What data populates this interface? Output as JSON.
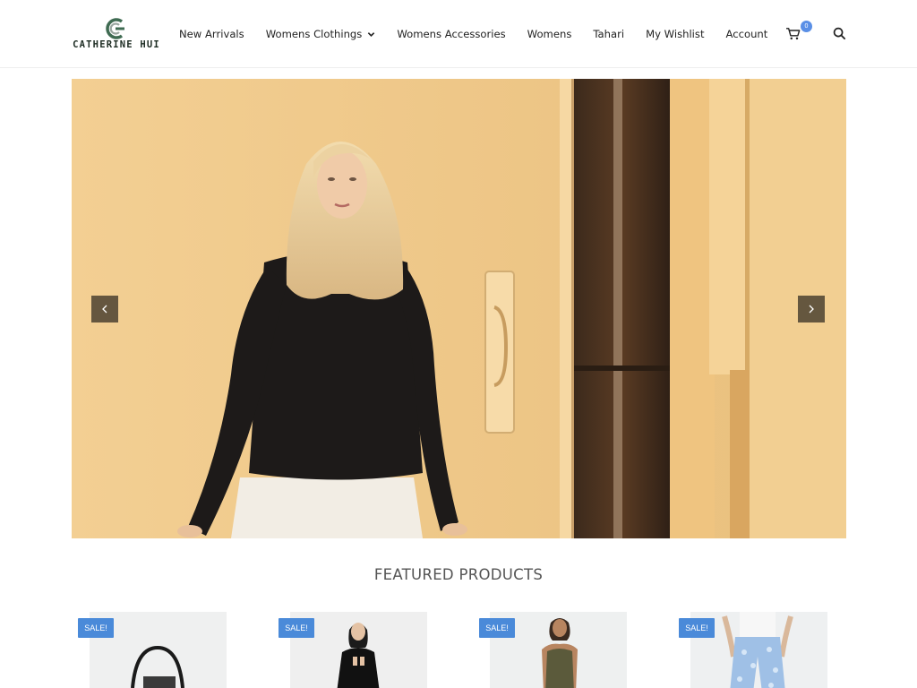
{
  "brand": {
    "name": "CATHERINE HUI"
  },
  "nav": {
    "items": [
      {
        "label": "New Arrivals"
      },
      {
        "label": "Womens Clothings"
      },
      {
        "label": "Womens Accessories"
      },
      {
        "label": "Womens"
      },
      {
        "label": "Tahari"
      },
      {
        "label": "My Wishlist"
      },
      {
        "label": "Account"
      }
    ]
  },
  "cart": {
    "count": "0",
    "icon": "cart-icon"
  },
  "search": {
    "icon": "search-icon"
  },
  "slider": {
    "prev_icon": "chevron-left-icon",
    "next_icon": "chevron-right-icon"
  },
  "featured": {
    "title": "FEATURED PRODUCTS",
    "products": [
      {
        "badge": "SALE!"
      },
      {
        "badge": "SALE!"
      },
      {
        "badge": "SALE!"
      },
      {
        "badge": "SALE!"
      }
    ]
  },
  "colors": {
    "accent": "#4a8ad9",
    "badge_blue": "#5a8fe6",
    "hero_wall": "#efc98a"
  }
}
